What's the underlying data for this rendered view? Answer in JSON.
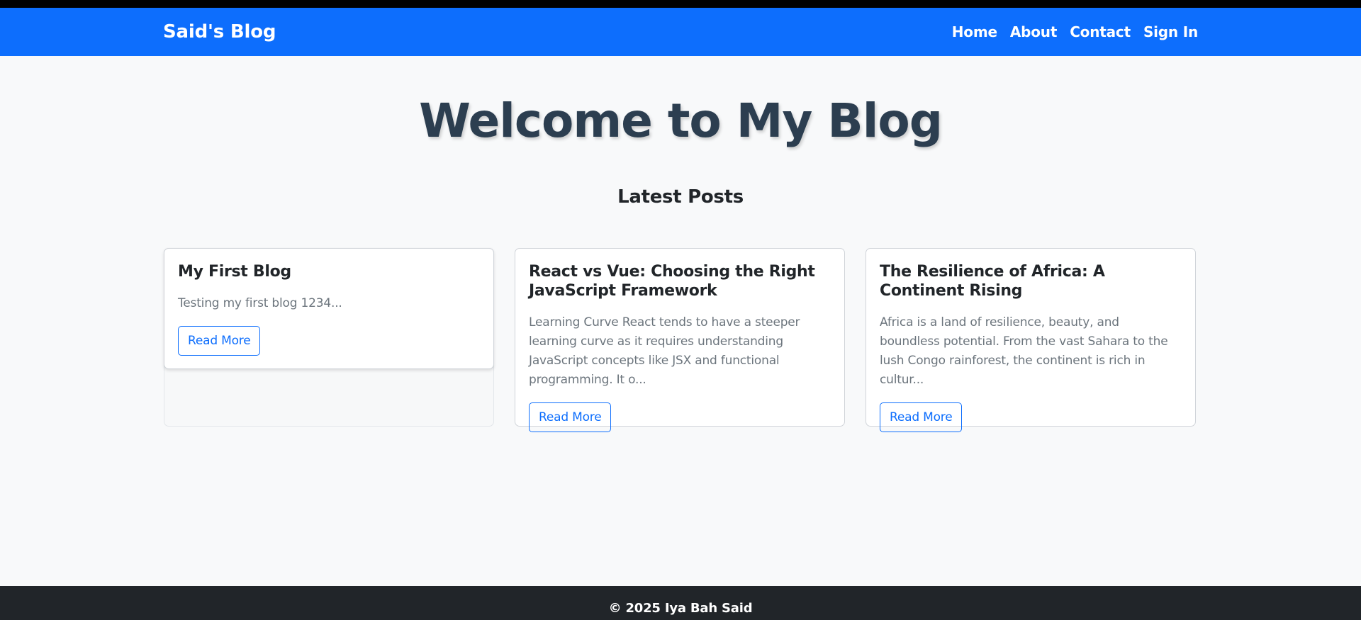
{
  "navbar": {
    "brand": "Said's Blog",
    "links": [
      "Home",
      "About",
      "Contact",
      "Sign In"
    ]
  },
  "hero": {
    "title": "Welcome to My Blog"
  },
  "section": {
    "title": "Latest Posts"
  },
  "posts": [
    {
      "title": "My First Blog",
      "excerpt": "Testing my first blog 1234...",
      "button": "Read More"
    },
    {
      "title": "React vs Vue: Choosing the Right JavaScript Framework",
      "excerpt": "Learning Curve React tends to have a steeper learning curve as it requires understanding JavaScript concepts like JSX and functional programming. It o...",
      "button": "Read More"
    },
    {
      "title": "The Resilience of Africa: A Continent Rising",
      "excerpt": "Africa is a land of resilience, beauty, and boundless potential. From the vast Sahara to the lush Congo rainforest, the continent is rich in cultur...",
      "button": "Read More"
    }
  ],
  "footer": {
    "text": "© 2025 Iya Bah Said"
  },
  "colors": {
    "navbar": "#0d6efd",
    "hero_title": "#2c3e50",
    "footer": "#212529",
    "button_border": "#0d6efd"
  }
}
